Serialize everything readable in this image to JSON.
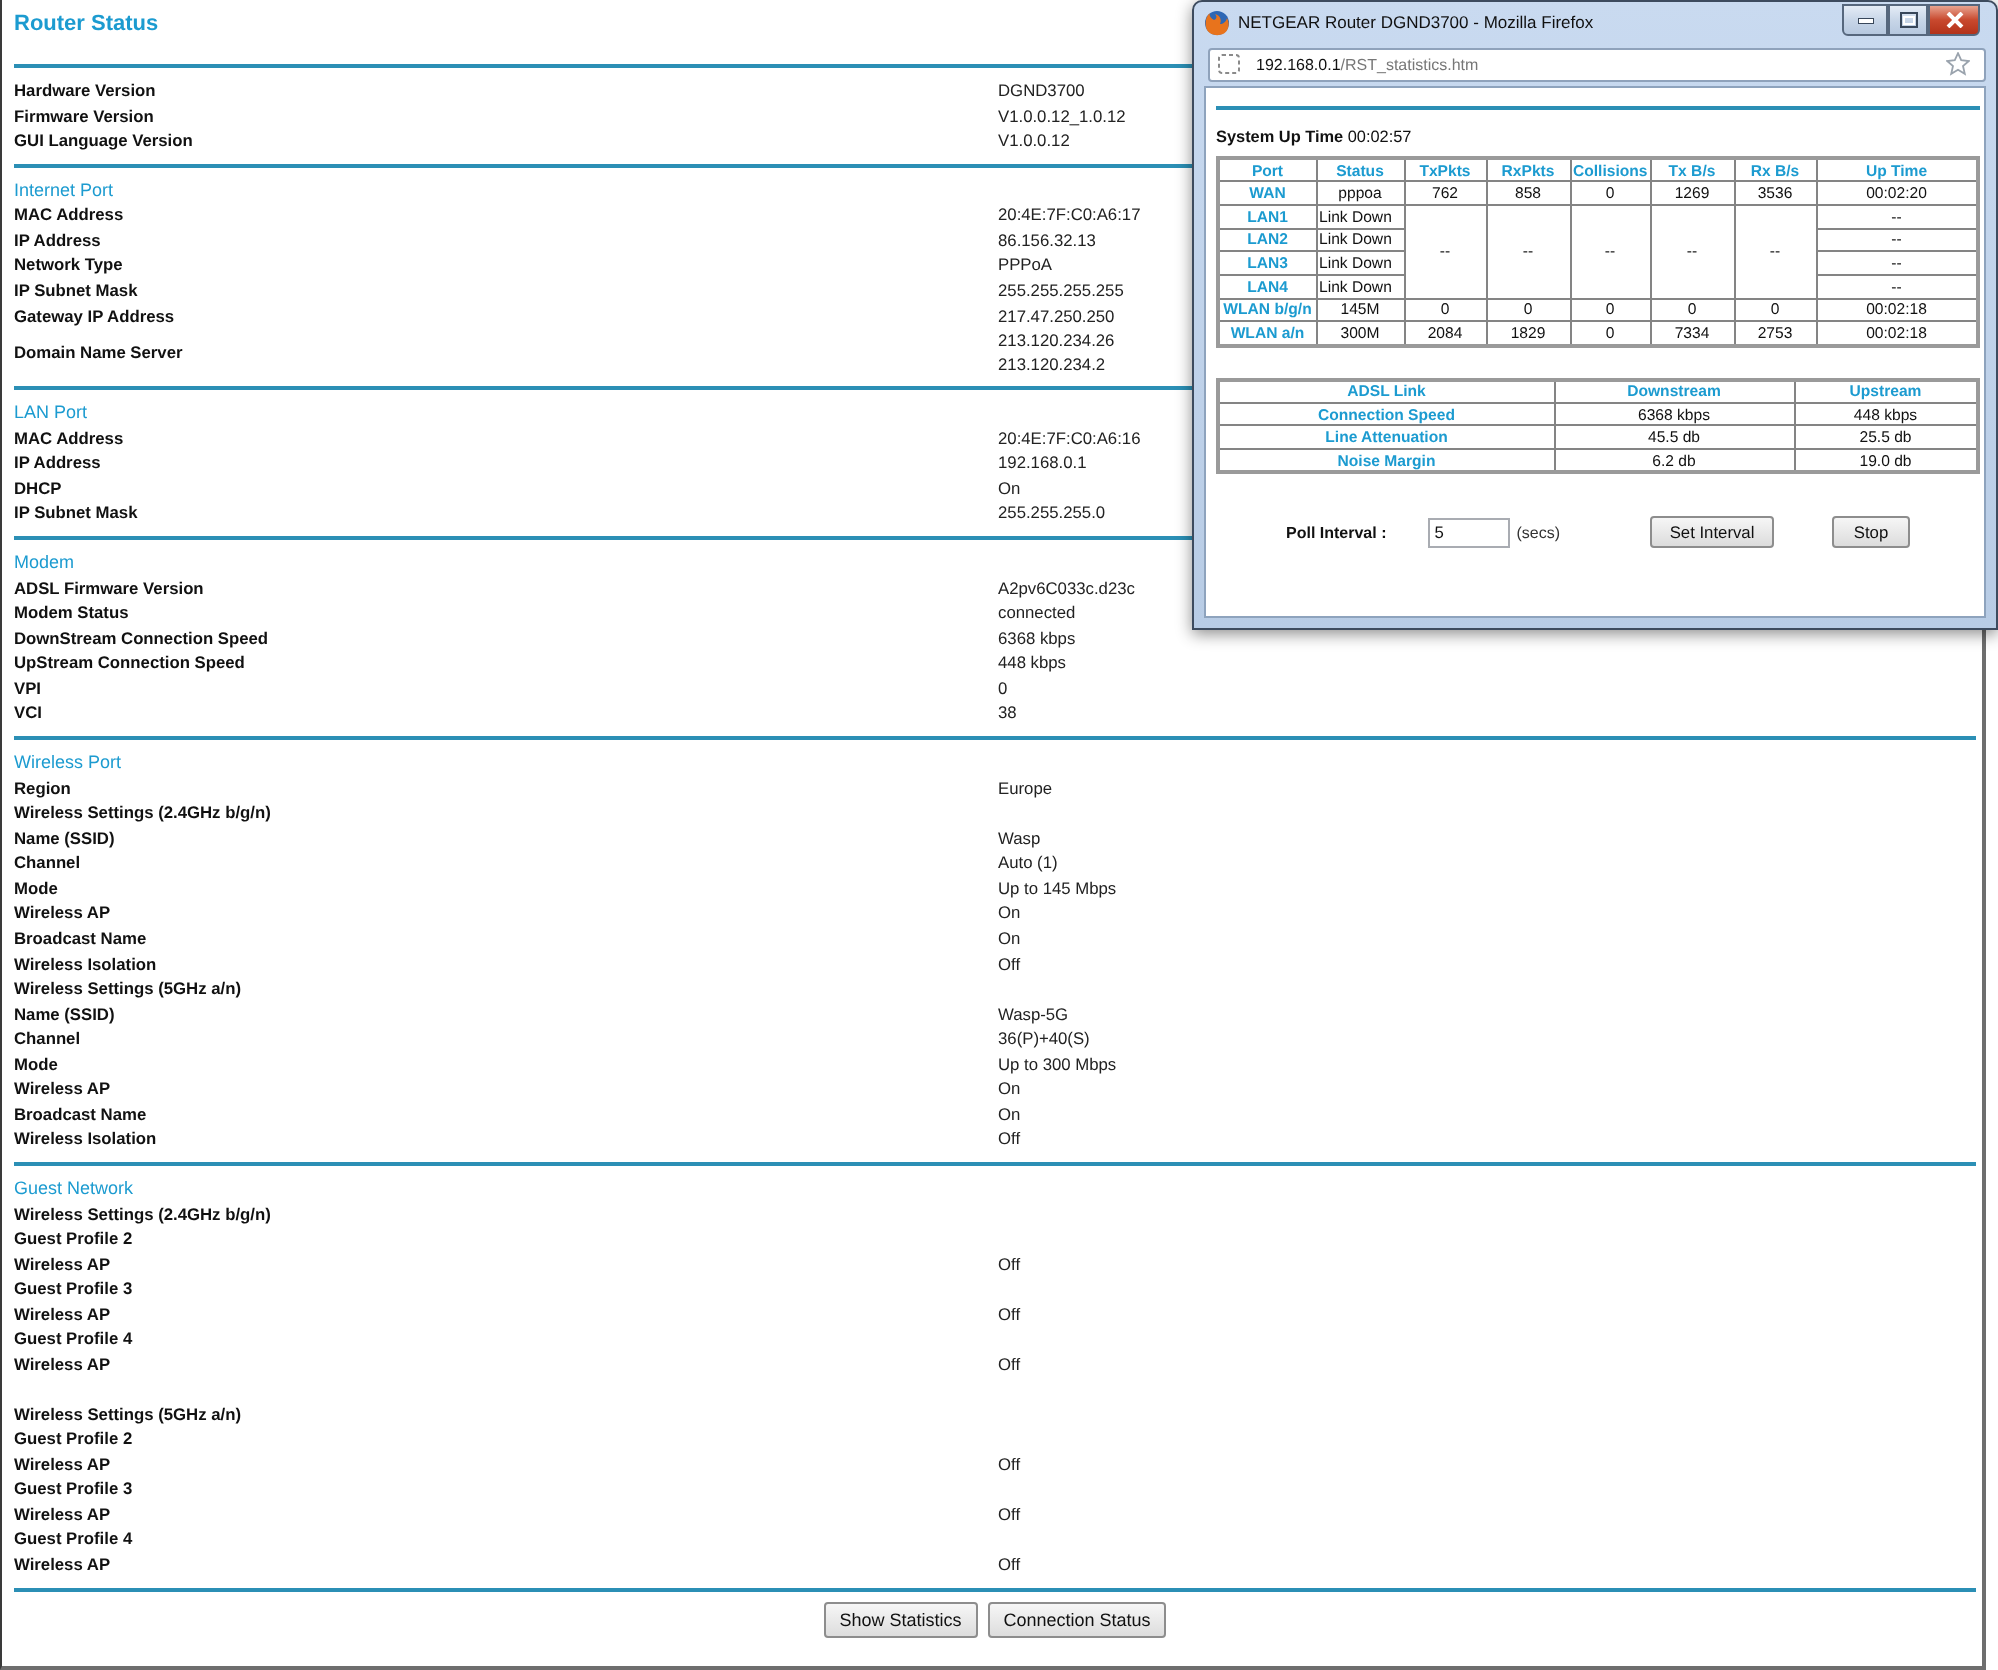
{
  "page": {
    "title": "Router Status",
    "sections": [
      {
        "groups": [
          {
            "rows": [
              {
                "label": "Hardware Version",
                "value": "DGND3700"
              },
              {
                "label": "Firmware Version",
                "value": "V1.0.0.12_1.0.12"
              },
              {
                "label": "GUI Language Version",
                "value": "V1.0.0.12"
              }
            ]
          }
        ]
      },
      {
        "heading": "Internet Port",
        "groups": [
          {
            "rows": [
              {
                "label": "MAC Address",
                "value": "20:4E:7F:C0:A6:17"
              },
              {
                "label": "IP Address",
                "value": "86.156.32.13"
              },
              {
                "label": "Network Type",
                "value": "PPPoA"
              },
              {
                "label": "IP Subnet Mask",
                "value": "255.255.255.255"
              },
              {
                "label": "Gateway IP Address",
                "value": "217.47.250.250"
              },
              {
                "label": "Domain Name Server",
                "values": [
                  "213.120.234.26",
                  "213.120.234.2"
                ]
              }
            ]
          }
        ]
      },
      {
        "heading": "LAN Port",
        "groups": [
          {
            "rows": [
              {
                "label": "MAC Address",
                "value": "20:4E:7F:C0:A6:16"
              },
              {
                "label": "IP Address",
                "value": "192.168.0.1"
              },
              {
                "label": "DHCP",
                "value": "On"
              },
              {
                "label": "IP Subnet Mask",
                "value": "255.255.255.0"
              }
            ]
          }
        ]
      },
      {
        "heading": "Modem",
        "groups": [
          {
            "rows": [
              {
                "label": "ADSL Firmware Version",
                "value": "A2pv6C033c.d23c"
              },
              {
                "label": "Modem Status",
                "value": "connected"
              },
              {
                "label": "DownStream Connection Speed",
                "value": "6368 kbps"
              },
              {
                "label": "UpStream Connection Speed",
                "value": "448 kbps"
              },
              {
                "label": "VPI",
                "value": "0"
              },
              {
                "label": "VCI",
                "value": "38"
              }
            ]
          }
        ]
      },
      {
        "heading": "Wireless Port",
        "groups": [
          {
            "rows": [
              {
                "label": "Region",
                "value": "Europe"
              },
              {
                "label": "Wireless Settings (2.4GHz b/g/n)"
              },
              {
                "label": "Name (SSID)",
                "value": "Wasp"
              },
              {
                "label": "Channel",
                "value": "Auto (1)"
              },
              {
                "label": "Mode",
                "value": "Up to 145 Mbps"
              },
              {
                "label": "Wireless AP",
                "value": "On"
              },
              {
                "label": "Broadcast Name",
                "value": "On"
              },
              {
                "label": "Wireless Isolation",
                "value": "Off"
              },
              {
                "label": "Wireless Settings (5GHz a/n)"
              },
              {
                "label": "Name (SSID)",
                "value": "Wasp-5G"
              },
              {
                "label": "Channel",
                "value": "36(P)+40(S)"
              },
              {
                "label": "Mode",
                "value": "Up to 300 Mbps"
              },
              {
                "label": "Wireless AP",
                "value": "On"
              },
              {
                "label": "Broadcast Name",
                "value": "On"
              },
              {
                "label": "Wireless Isolation",
                "value": "Off"
              }
            ]
          }
        ]
      },
      {
        "heading": "Guest Network",
        "groups": [
          {
            "rows": [
              {
                "label": "Wireless Settings (2.4GHz b/g/n)"
              },
              {
                "label": "Guest Profile 2"
              },
              {
                "label": "Wireless AP",
                "value": "Off"
              },
              {
                "label": "Guest Profile 3"
              },
              {
                "label": "Wireless AP",
                "value": "Off"
              },
              {
                "label": "Guest Profile 4"
              },
              {
                "label": "Wireless AP",
                "value": "Off"
              }
            ]
          },
          {
            "rows": [
              {
                "label": "Wireless Settings (5GHz a/n)"
              },
              {
                "label": "Guest Profile 2"
              },
              {
                "label": "Wireless AP",
                "value": "Off"
              },
              {
                "label": "Guest Profile 3"
              },
              {
                "label": "Wireless AP",
                "value": "Off"
              },
              {
                "label": "Guest Profile 4"
              },
              {
                "label": "Wireless AP",
                "value": "Off"
              }
            ]
          }
        ]
      }
    ],
    "buttons": [
      "Show Statistics",
      "Connection Status"
    ]
  },
  "popup": {
    "title": "NETGEAR Router DGND3700 - Mozilla Firefox",
    "address": {
      "host": "192.168.0.1",
      "path": "/RST_statistics.htm"
    },
    "uptime": {
      "label": "System Up Time",
      "value": "00:02:57"
    },
    "port_table": {
      "columns": [
        "Port",
        "Status",
        "TxPkts",
        "RxPkts",
        "Collisions",
        "Tx B/s",
        "Rx B/s",
        "Up Time"
      ],
      "rows": [
        {
          "kind": "full",
          "cells": [
            "WAN",
            "pppoa",
            "762",
            "858",
            "0",
            "1269",
            "3536",
            "00:02:20"
          ]
        },
        {
          "kind": "link",
          "port": "LAN1",
          "status": "Link Down",
          "up_time": "--"
        },
        {
          "kind": "link",
          "port": "LAN2",
          "status": "Link Down",
          "up_time": "--"
        },
        {
          "kind": "link",
          "port": "LAN3",
          "status": "Link Down",
          "up_time": "--"
        },
        {
          "kind": "link",
          "port": "LAN4",
          "status": "Link Down",
          "up_time": "--"
        },
        {
          "kind": "full",
          "cells": [
            "WLAN b/g/n",
            "145M",
            "0",
            "0",
            "0",
            "0",
            "0",
            "00:02:18"
          ]
        },
        {
          "kind": "full",
          "cells": [
            "WLAN a/n",
            "300M",
            "2084",
            "1829",
            "0",
            "7334",
            "2753",
            "00:02:18"
          ]
        }
      ],
      "merged_cells": [
        "--",
        "--",
        "--",
        "--",
        "--"
      ]
    },
    "adsl_table": {
      "columns": [
        "ADSL Link",
        "Downstream",
        "Upstream"
      ],
      "rows": [
        [
          "Connection Speed",
          "6368 kbps",
          "448 kbps"
        ],
        [
          "Line Attenuation",
          "45.5 db",
          "25.5 db"
        ],
        [
          "Noise Margin",
          "6.2 db",
          "19.0 db"
        ]
      ]
    },
    "poll": {
      "label": "Poll Interval :",
      "value": "5",
      "unit": "(secs)"
    },
    "buttons": [
      "Set Interval",
      "Stop"
    ]
  }
}
